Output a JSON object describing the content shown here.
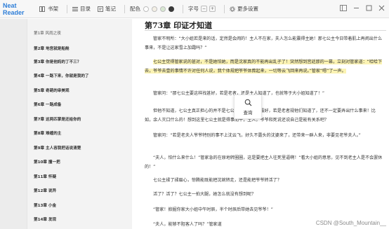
{
  "app": {
    "name": "Neat Reader"
  },
  "toolbar": {
    "bookshelf": "书架",
    "toc": "目录",
    "notes": "笔记",
    "color_label": "配色",
    "swatches": [
      "#ffffff",
      "#f4f0e6",
      "#d8e8d2",
      "#3a3a3a"
    ],
    "font_label": "字号",
    "more_settings": "更多设置"
  },
  "sidebar": {
    "items": [
      "第1章 风雨之夜",
      "第2章 地宫就是船舱",
      "第3章 你是他妈的丁不三？",
      "第4章 一路下来，你就是我的了",
      "第5章 奇葩的审美观",
      "第6章 一路成备",
      "第7章 这两匹掌是还给你的",
      "第8章 难缠的主",
      "第9章 主人容我把话说清楚",
      "第10章 撞一把",
      "第11章 怀疑",
      "第12章 说异",
      "第13章 小金",
      "第14章 发现"
    ]
  },
  "reader": {
    "chapter_title": "第73章 印证才知道",
    "paragraphs": [
      "管家不明所：“大小姐若是来的话，定然是会闹的！主人不在家，夫人怎么能震得主她！那七公主今日带着肌上再闹出什么事来，不是让这家雪上加霜吗？”",
      "七公主觉得管家说的甚对，不是她怕她，而是沈家真的不能再出乱子了！突然想到宫廷那的一幕，立刻对管家道：“哈哈下去，爷爷去壹的事情不许对任何人说，我个体规把爷爷体葬起来，一切等云飞回来再说。”管家“嗯”了一声。",
      "管家问：“那七公主要这样找甚好，若是老者，还是主人知道了，也就等于大小姐知道了！”",
      "但他不知道，七公主真正担心的并不是七公主，事情一旦最好，若是老者规他们知道了，还不一定要弄出什么事来！比如，余人灭口什么的！想到这里七公主就是得事而平，主人，爷爷和死说还说自己是能有关系吧？",
      "管家问：“若是老夫人爷爷特别的事不上沈云飞，好久不露头的沈婆来了，还带来一群人来，非要见老爷夫人。”",
      "“夫人，怕什么来什么！”管家急的在原地转圈圈，这是要把主人往死里逼啊！“看大小姐的意思，见不到老主人是不会罢休的！”",
      "七公主揉了揉眉心，惊腾能既能把沈婉转走，还是能把爷爷转活了？",
      "活了？活了？七公主一拍大腿，她怎么就没有想到呢？",
      "“管家！掀掘你家大小姐中午时辰，半个时辰后带她去见爷爷！”",
      "“夫人，能够不阻客人了吗？”管家道"
    ],
    "popup_label": "查询"
  },
  "watermark": "CSDN @South_Mountain__"
}
